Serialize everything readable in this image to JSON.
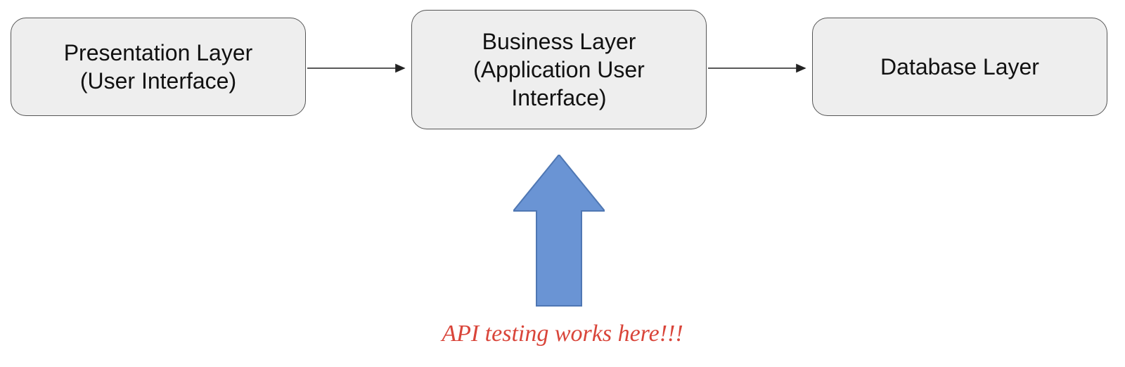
{
  "boxes": {
    "presentation": "Presentation Layer\n(User Interface)",
    "business": "Business Layer\n(Application User\nInterface)",
    "database": "Database Layer"
  },
  "caption": "API testing works here!!!",
  "colors": {
    "box_fill": "#eeeeee",
    "box_stroke": "#555555",
    "arrow_thin": "#222222",
    "arrow_big_fill": "#6a94d4",
    "arrow_big_stroke": "#4f77b3",
    "caption": "#d9453a"
  }
}
